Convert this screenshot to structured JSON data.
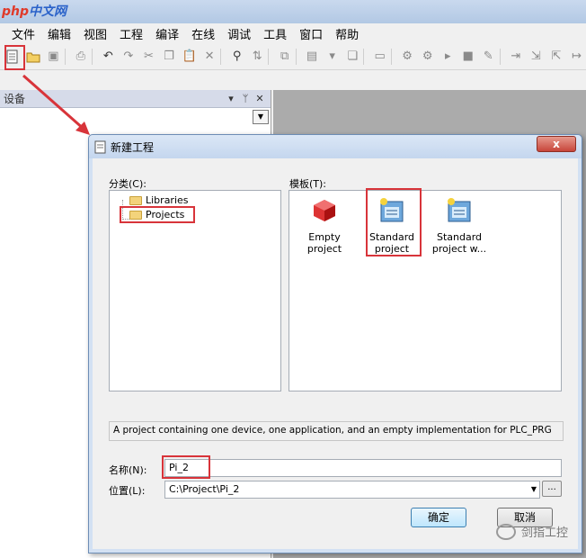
{
  "watermark": {
    "part1": "php",
    "part2": "中文网"
  },
  "menu": [
    "文件",
    "编辑",
    "视图",
    "工程",
    "编译",
    "在线",
    "调试",
    "工具",
    "窗口",
    "帮助"
  ],
  "toolbar_icons": [
    "new-project-icon",
    "open-icon",
    "save-icon",
    "print-icon",
    "undo-icon",
    "redo-icon",
    "cut-icon",
    "copy-icon",
    "paste-icon",
    "delete-icon",
    "find-icon",
    "replace-icon",
    "bookmark-icon",
    "build-icon",
    "run-icon",
    "stop-icon",
    "tools-icon",
    "step-icon"
  ],
  "panel": {
    "title": "设备",
    "pin": "▾",
    "dock": "ᛘ",
    "close": "✕"
  },
  "dialog": {
    "title": "新建工程",
    "close": "x",
    "category_label": "分类(C):",
    "template_label": "模板(T):",
    "categories": [
      "Libraries",
      "Projects"
    ],
    "templates": [
      {
        "line1": "Empty project",
        "line2": ""
      },
      {
        "line1": "Standard",
        "line2": "project"
      },
      {
        "line1": "Standard",
        "line2": "project w..."
      }
    ],
    "description": "A project containing one device, one application, and an empty implementation for PLC_PRG",
    "name_label": "名称(N):",
    "name_value": "Pi_2",
    "location_label": "位置(L):",
    "location_value": "C:\\Project\\Pi_2",
    "browse_label": "...",
    "ok_label": "确定",
    "cancel_label": "取消"
  },
  "brand": "剑指工控"
}
